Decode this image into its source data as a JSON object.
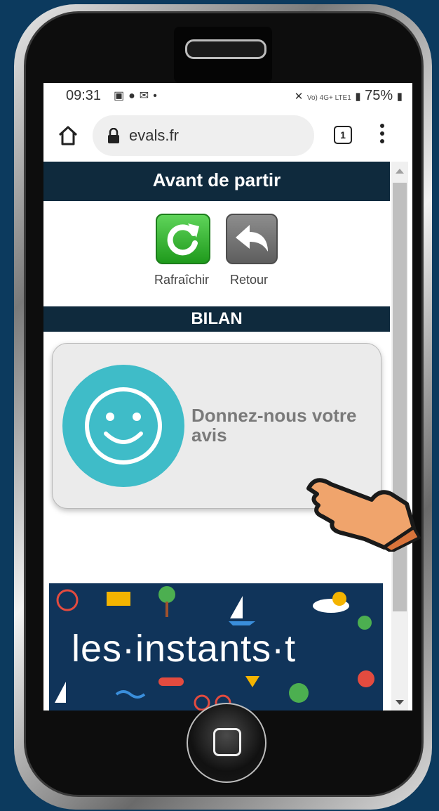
{
  "status_bar": {
    "time": "09:31",
    "notification_icons": [
      "image-icon",
      "circle-face-icon",
      "mail-icon",
      "dot"
    ],
    "signal_text": "Vo) 4G+ LTE1",
    "battery": "75%"
  },
  "browser": {
    "url": "evals.fr",
    "tab_count": "1"
  },
  "page": {
    "header_title": "Avant de partir",
    "refresh_label": "Rafraîchir",
    "back_label": "Retour",
    "section_title": "BILAN",
    "feedback_text": "Donnez-nous votre avis",
    "banner_text": "les·instants·t"
  },
  "colors": {
    "background": "#0c3a5e",
    "header_bg": "#0f2a3d",
    "smiley": "#3fbcc8",
    "refresh_green": "#2aa626",
    "banner_bg": "#10345a"
  }
}
